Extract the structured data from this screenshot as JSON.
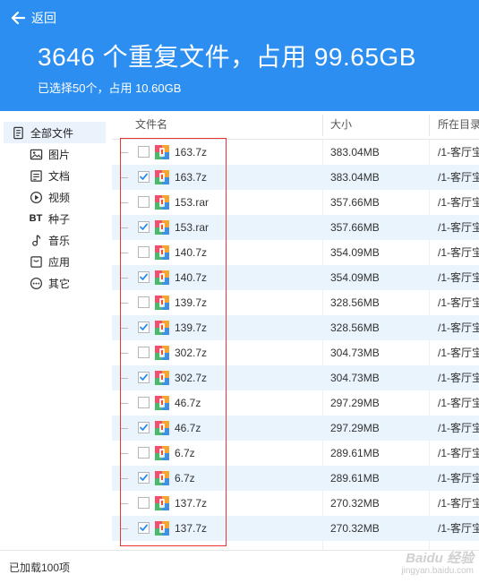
{
  "header": {
    "back_label": "返回",
    "title": "3646 个重复文件，占用 99.65GB",
    "subtitle": "已选择50个，占用 10.60GB",
    "bg_color": "#2b8ef0"
  },
  "sidebar": {
    "items": [
      {
        "label": "全部文件",
        "icon": "file-list-icon",
        "active": true
      },
      {
        "label": "图片",
        "icon": "picture-icon",
        "active": false
      },
      {
        "label": "文档",
        "icon": "document-icon",
        "active": false
      },
      {
        "label": "视频",
        "icon": "video-play-icon",
        "active": false
      },
      {
        "label": "种子",
        "icon": "bt-icon",
        "icon_text": "BT",
        "active": false
      },
      {
        "label": "音乐",
        "icon": "music-note-icon",
        "active": false
      },
      {
        "label": "应用",
        "icon": "app-icon",
        "active": false
      },
      {
        "label": "其它",
        "icon": "more-icon",
        "active": false
      }
    ]
  },
  "table": {
    "headers": {
      "name": "文件名",
      "size": "大小",
      "path": "所在目录"
    },
    "rows": [
      {
        "name": "163.7z",
        "size": "383.04MB",
        "path": "/1-客厅宝",
        "checked": false
      },
      {
        "name": "163.7z",
        "size": "383.04MB",
        "path": "/1-客厅宝",
        "checked": true
      },
      {
        "name": "153.rar",
        "size": "357.66MB",
        "path": "/1-客厅宝",
        "checked": false
      },
      {
        "name": "153.rar",
        "size": "357.66MB",
        "path": "/1-客厅宝",
        "checked": true
      },
      {
        "name": "140.7z",
        "size": "354.09MB",
        "path": "/1-客厅宝",
        "checked": false
      },
      {
        "name": "140.7z",
        "size": "354.09MB",
        "path": "/1-客厅宝",
        "checked": true
      },
      {
        "name": "139.7z",
        "size": "328.56MB",
        "path": "/1-客厅宝",
        "checked": false
      },
      {
        "name": "139.7z",
        "size": "328.56MB",
        "path": "/1-客厅宝",
        "checked": true
      },
      {
        "name": "302.7z",
        "size": "304.73MB",
        "path": "/1-客厅宝",
        "checked": false
      },
      {
        "name": "302.7z",
        "size": "304.73MB",
        "path": "/1-客厅宝",
        "checked": true
      },
      {
        "name": "46.7z",
        "size": "297.29MB",
        "path": "/1-客厅宝",
        "checked": false
      },
      {
        "name": "46.7z",
        "size": "297.29MB",
        "path": "/1-客厅宝",
        "checked": true
      },
      {
        "name": "6.7z",
        "size": "289.61MB",
        "path": "/1-客厅宝",
        "checked": false
      },
      {
        "name": "6.7z",
        "size": "289.61MB",
        "path": "/1-客厅宝",
        "checked": true
      },
      {
        "name": "137.7z",
        "size": "270.32MB",
        "path": "/1-客厅宝",
        "checked": false
      },
      {
        "name": "137.7z",
        "size": "270.32MB",
        "path": "/1-客厅宝",
        "checked": true
      }
    ]
  },
  "footer": {
    "status": "已加载100项",
    "watermark_logo": "Baidu 经验",
    "watermark_url": "jingyan.baidu.com"
  },
  "colors": {
    "accent": "#2b8ef0",
    "checked_row": "#e9f4fd",
    "highlight_box": "#e33"
  }
}
